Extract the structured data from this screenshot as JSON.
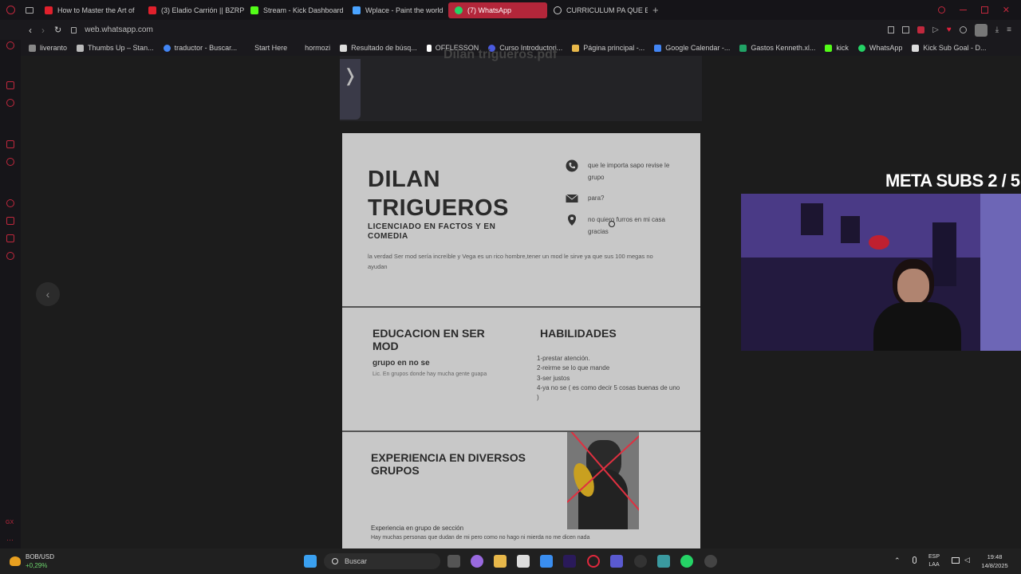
{
  "tabs": [
    {
      "label": "How to Master the Art of",
      "color": "#e0202c"
    },
    {
      "label": "(3) Eladio Carrión || BZRP",
      "color": "#e0202c"
    },
    {
      "label": "Stream - Kick Dashboard",
      "color": "#53fc18"
    },
    {
      "label": "Wplace - Paint the world",
      "color": "#4aa3ff"
    },
    {
      "label": "(7) WhatsApp",
      "color": "#25d366"
    },
    {
      "label": "CURRICULUM PA QUE EL",
      "color": "#9aa0a6"
    }
  ],
  "address": {
    "url": "web.whatsapp.com"
  },
  "bookmarks": [
    {
      "label": "liveranto",
      "color": "#888"
    },
    {
      "label": "Thumbs Up – Stan...",
      "color": "#bbb"
    },
    {
      "label": "traductor - Buscar...",
      "color": "#4285f4"
    },
    {
      "label": "Start Here",
      "color": "#555"
    },
    {
      "label": "hormozi",
      "color": "#555"
    },
    {
      "label": "Resultado de búsq...",
      "color": "#ddd"
    },
    {
      "label": "OFFLESSON",
      "color": "#fff"
    },
    {
      "label": "Curso Introductori...",
      "color": "#4a5adf"
    },
    {
      "label": "Página principal -...",
      "color": "#e8b84a"
    },
    {
      "label": "Google Calendar -...",
      "color": "#4285f4"
    },
    {
      "label": "Gastos Kenneth.xl...",
      "color": "#21a366"
    },
    {
      "label": "kick",
      "color": "#53fc18"
    },
    {
      "label": "WhatsApp",
      "color": "#25d366"
    },
    {
      "label": "Kick Sub Goal - D...",
      "color": "#ddd"
    }
  ],
  "prev_title": "Dilan trigueros.pdf",
  "cv": {
    "name": "DILAN\nTRIGUEROS",
    "role": "LICENCIADO EN FACTOS Y EN COMEDIA",
    "bio": "la verdad Ser mod sería increíble y Vega es un rico hombre,tener un mod le sirve ya que sus 100 megas no ayudan",
    "contacts": [
      {
        "icon": "phone-icon",
        "text": "que le importa sapo revise le grupo"
      },
      {
        "icon": "mail-icon",
        "text": "para?"
      },
      {
        "icon": "location-icon",
        "text": "no quiero furros en mi casa gracias"
      }
    ],
    "edu_title": "EDUCACION EN SER MOD",
    "edu_sub": "grupo en no se",
    "edu_text": "Lic. En grupos donde hay mucha gente guapa",
    "skills_title": "HABILIDADES",
    "skills": [
      "1-prestar atención.",
      "2-reirme se lo que mande",
      "3-ser justos",
      "4-ya no se ( es como decir 5 cosas buenas de uno )"
    ],
    "exp_title": "EXPERIENCIA EN DIVERSOS GRUPOS",
    "exp_sub": "Experiencia en grupo de sección",
    "exp_text": "Hay muchas personas que dudan de mi pero como no hago ni mierda no me dicen nada"
  },
  "overlay": {
    "meta_subs": "META SUBS  2 / 5"
  },
  "taskbar": {
    "ticker": "BOB/USD",
    "ticker_change": "+0,29%",
    "search": "Buscar",
    "lang": "ESP",
    "lang2": "LAA",
    "time": "19:48",
    "date": "14/8/2025"
  }
}
